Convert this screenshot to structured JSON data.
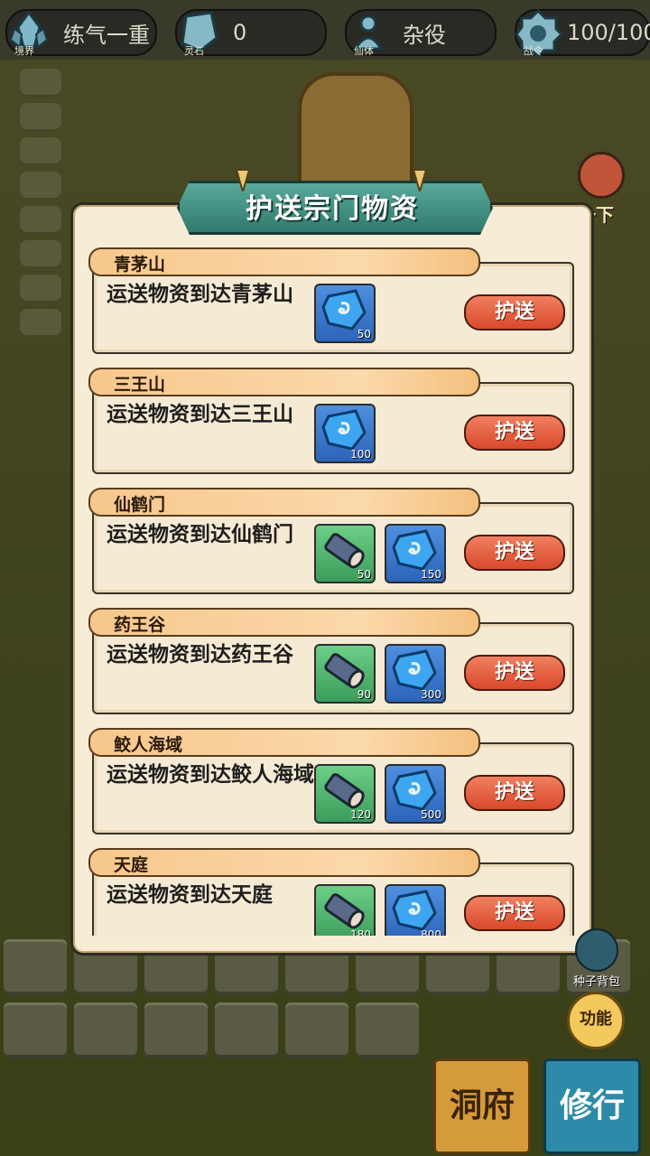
{
  "topbar": {
    "realm": {
      "caption": "境界",
      "value": "练气一重"
    },
    "stone": {
      "caption": "灵石",
      "value": "0"
    },
    "body": {
      "caption": "仙体",
      "value": "杂役"
    },
    "power": {
      "caption": "战令",
      "value": "100/100"
    }
  },
  "side": {
    "bag_label": "一下"
  },
  "dialog": {
    "title": "护送宗门物资",
    "entries": [
      {
        "name": "青茅山",
        "desc": "运送物资到达青茅山",
        "button": "护送",
        "rewards": [
          {
            "type": "spirit-stone",
            "count": "50"
          }
        ]
      },
      {
        "name": "三王山",
        "desc": "运送物资到达三王山",
        "button": "护送",
        "rewards": [
          {
            "type": "spirit-stone",
            "count": "100"
          }
        ]
      },
      {
        "name": "仙鹤门",
        "desc": "运送物资到达仙鹤门",
        "button": "护送",
        "rewards": [
          {
            "type": "wood-log",
            "count": "50"
          },
          {
            "type": "spirit-stone",
            "count": "150"
          }
        ]
      },
      {
        "name": "药王谷",
        "desc": "运送物资到达药王谷",
        "button": "护送",
        "rewards": [
          {
            "type": "wood-log",
            "count": "90"
          },
          {
            "type": "spirit-stone",
            "count": "300"
          }
        ]
      },
      {
        "name": "鲛人海域",
        "desc": "运送物资到达鲛人海域",
        "button": "护送",
        "rewards": [
          {
            "type": "wood-log",
            "count": "120"
          },
          {
            "type": "spirit-stone",
            "count": "500"
          }
        ]
      },
      {
        "name": "天庭",
        "desc": "运送物资到达天庭",
        "button": "护送",
        "rewards": [
          {
            "type": "wood-log",
            "count": "180"
          },
          {
            "type": "spirit-stone",
            "count": "800"
          }
        ]
      }
    ]
  },
  "bottom": {
    "seed_bag": "种子背包",
    "function": "功能",
    "cave": "洞府",
    "cultivate": "修行"
  }
}
